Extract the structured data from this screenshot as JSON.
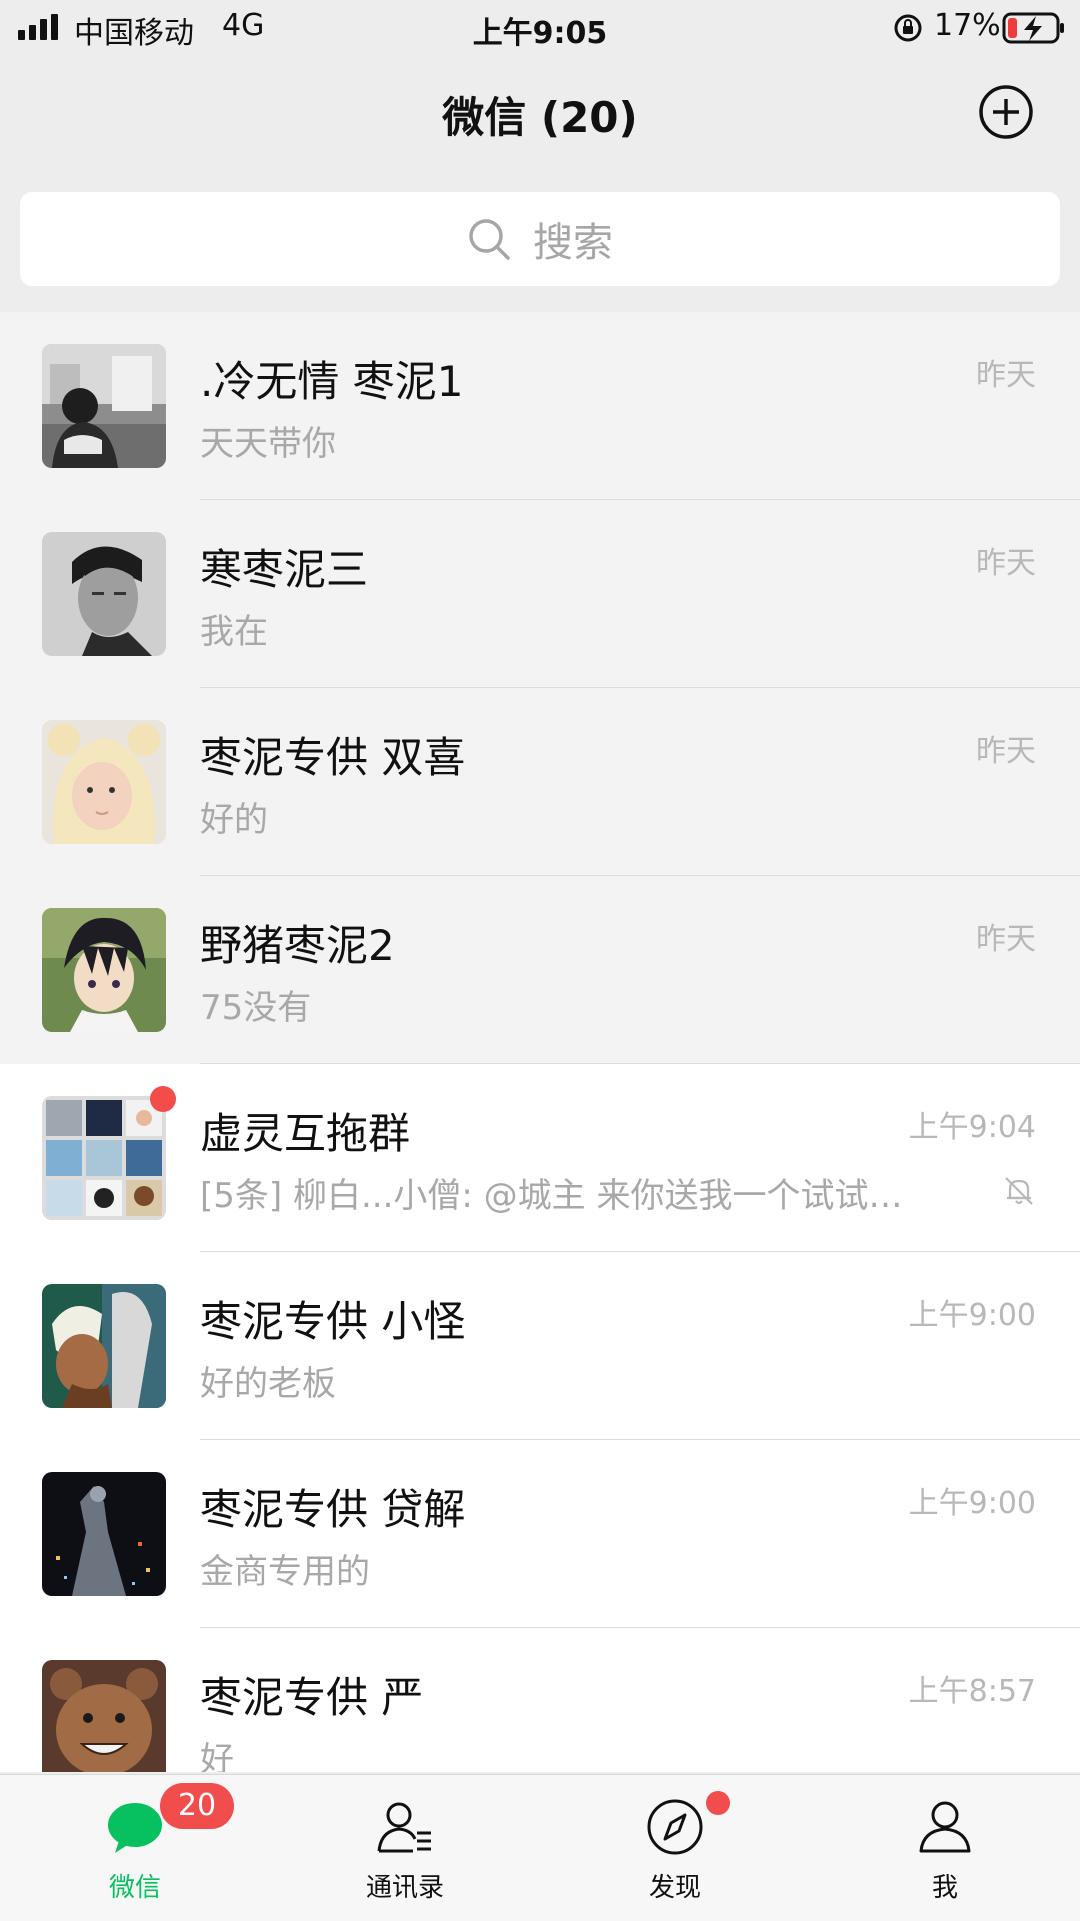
{
  "status_bar": {
    "carrier": "中国移动",
    "network": "4G",
    "time": "上午9:05",
    "battery_percent": "17%"
  },
  "header": {
    "title": "微信 (20)"
  },
  "search": {
    "placeholder": "搜索"
  },
  "chats": [
    {
      "name": ".冷无情  枣泥1",
      "preview": "天天带你",
      "time": "昨天",
      "pinned": true,
      "avatar": "photo-boy-street-icon"
    },
    {
      "name": "寒枣泥三",
      "preview": "我在",
      "time": "昨天",
      "pinned": true,
      "avatar": "photo-man-portrait-icon"
    },
    {
      "name": "枣泥专供  双喜",
      "preview": "好的",
      "time": "昨天",
      "pinned": true,
      "avatar": "photo-child-hood-icon"
    },
    {
      "name": "野猪枣泥2",
      "preview": "75没有",
      "time": "昨天",
      "pinned": true,
      "avatar": "anime-boy-icon"
    },
    {
      "name": "虚灵互拖群",
      "preview": "[5条] 柳白...小僧: @城主 来你送我一个试试…",
      "time": "上午9:04",
      "pinned": false,
      "avatar": "group-grid-icon",
      "unread_dot": true,
      "muted": true
    },
    {
      "name": "枣泥专供 小怪",
      "preview": "好的老板",
      "time": "上午9:00",
      "pinned": false,
      "avatar": "cartoon-character-icon"
    },
    {
      "name": "枣泥专供 贷解",
      "preview": "金商专用的",
      "time": "上午9:00",
      "pinned": false,
      "avatar": "dark-city-icon"
    },
    {
      "name": "枣泥专供 严",
      "preview": "好",
      "time": "上午8:57",
      "pinned": false,
      "avatar": "cartoon-bear-icon"
    }
  ],
  "tabs": [
    {
      "label": "微信",
      "icon": "chat-bubble-icon",
      "active": true,
      "badge": "20"
    },
    {
      "label": "通讯录",
      "icon": "contacts-icon",
      "active": false
    },
    {
      "label": "发现",
      "icon": "compass-icon",
      "active": false,
      "dot": true
    },
    {
      "label": "我",
      "icon": "person-icon",
      "active": false
    }
  ],
  "colors": {
    "accent": "#07c160",
    "badge": "#f24d4d",
    "background": "#ededed"
  }
}
